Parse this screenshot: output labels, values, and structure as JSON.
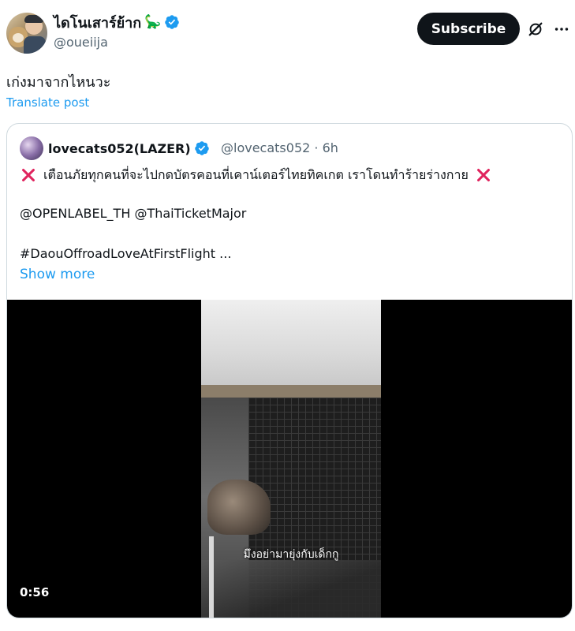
{
  "author": {
    "display_name": "ไดโนเสาร์ย้าก",
    "name_emoji": "🦕",
    "handle": "@oueiija",
    "verified": true
  },
  "header_actions": {
    "subscribe_label": "Subscribe",
    "grok_icon": "grok-icon",
    "more_icon": "more-horizontal-icon"
  },
  "post": {
    "text": "เก่งมาจากไหนวะ",
    "translate_label": "Translate post"
  },
  "quoted_post": {
    "display_name": "lovecats052(LAZER)",
    "handle": "@lovecats052",
    "separator": "·",
    "time": "6h",
    "verified": true,
    "text_line1": "เตือนภัยทุกคนที่จะไปกดบัตรคอนที่เคาน์เตอร์ไทยทิคเกต เราโดนทำร้ายร่างกาย",
    "text_line2": "@OPENLABEL_TH @ThaiTicketMajor",
    "text_line3": "#DaouOffroadLoveAtFirstFlight ...",
    "show_more_label": "Show more",
    "video": {
      "subtitle": "มึงอย่ามายุ่งกับเด็กกู",
      "duration": "0:56"
    }
  },
  "colors": {
    "link": "#1d9bf0",
    "verified": "#1d9bf0",
    "x_mark": "#e0245e",
    "subscribe_bg": "#0f1419",
    "secondary_text": "#536471"
  }
}
